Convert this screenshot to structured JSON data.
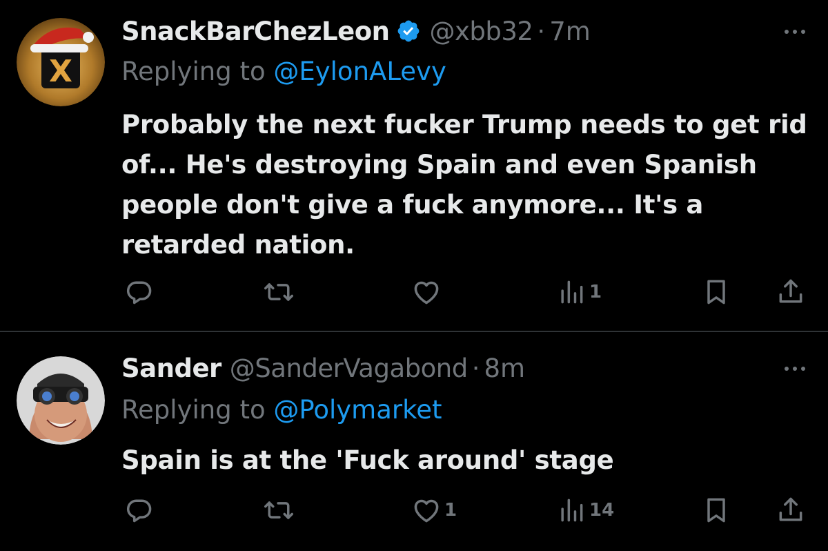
{
  "tweets": [
    {
      "display_name": "SnackBarChezLeon",
      "verified": true,
      "handle": "@xbb32",
      "separator": "·",
      "time": "7m",
      "reply_prefix": "Replying to",
      "reply_to": "@EylonALevy",
      "text": "Probably the next fucker Trump needs to get rid of... He's destroying Spain and even Spanish people don't give a fuck anymore... It's a retarded nation.",
      "replies": "",
      "retweets": "",
      "likes": "",
      "views": "1",
      "avatar": "x-logo-santa-hat-icon"
    },
    {
      "display_name": "Sander",
      "verified": false,
      "handle": "@SanderVagabond",
      "separator": "·",
      "time": "8m",
      "reply_prefix": "Replying to",
      "reply_to": "@Polymarket",
      "text": "Spain is at the 'Fuck around' stage",
      "replies": "",
      "retweets": "",
      "likes": "1",
      "views": "14",
      "avatar": "night-vision-goggles-avatar"
    }
  ],
  "colors": {
    "background": "#000000",
    "text": "#e7e9ea",
    "muted": "#71767b",
    "link": "#1d9bf0",
    "divider": "#2f3336"
  }
}
